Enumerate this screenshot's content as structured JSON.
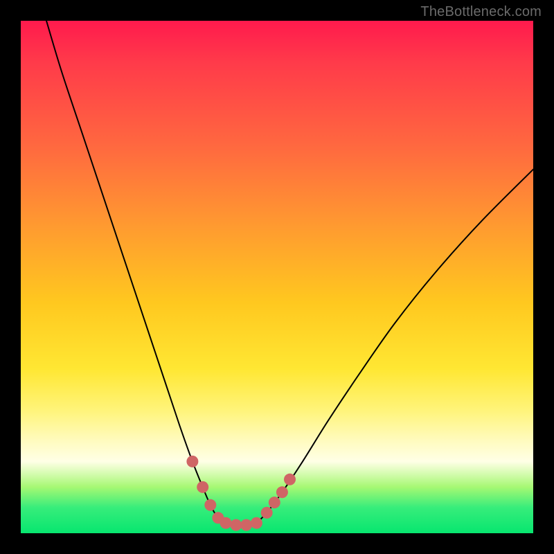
{
  "watermark": "TheBottleneck.com",
  "colors": {
    "background": "#000000",
    "curve": "#000000",
    "marker": "#cf6565",
    "gradient_stops": [
      "#ff1a4d",
      "#ff6a3f",
      "#ffc81f",
      "#fff47a",
      "#ffffe6",
      "#37ed7b",
      "#07e66f"
    ]
  },
  "chart_data": {
    "type": "line",
    "title": "",
    "xlabel": "",
    "ylabel": "",
    "xlim": [
      0,
      100
    ],
    "ylim": [
      0,
      100
    ],
    "series": [
      {
        "name": "left-branch",
        "x": [
          5,
          8,
          12,
          16,
          20,
          24,
          28,
          31,
          33.5,
          35.5,
          37,
          38.5,
          40
        ],
        "y": [
          100,
          90,
          78,
          66,
          54,
          42,
          30,
          21,
          14,
          9,
          5.5,
          3,
          2
        ]
      },
      {
        "name": "right-branch",
        "x": [
          46,
          48,
          51,
          55,
          60,
          66,
          73,
          81,
          90,
          100
        ],
        "y": [
          2,
          4,
          8,
          14,
          22,
          31,
          41,
          51,
          61,
          71
        ]
      },
      {
        "name": "valley-floor",
        "x": [
          40,
          42,
          44,
          46
        ],
        "y": [
          2,
          1.6,
          1.6,
          2
        ]
      }
    ],
    "markers": {
      "name": "highlighted-segment",
      "color": "#cf6565",
      "points": [
        {
          "x": 33.5,
          "y": 14
        },
        {
          "x": 35.5,
          "y": 9
        },
        {
          "x": 37,
          "y": 5.5
        },
        {
          "x": 38.5,
          "y": 3
        },
        {
          "x": 40,
          "y": 2
        },
        {
          "x": 42,
          "y": 1.6
        },
        {
          "x": 44,
          "y": 1.6
        },
        {
          "x": 46,
          "y": 2
        },
        {
          "x": 48,
          "y": 4
        },
        {
          "x": 49.5,
          "y": 6
        },
        {
          "x": 51,
          "y": 8
        },
        {
          "x": 52.5,
          "y": 10.5
        }
      ]
    }
  }
}
